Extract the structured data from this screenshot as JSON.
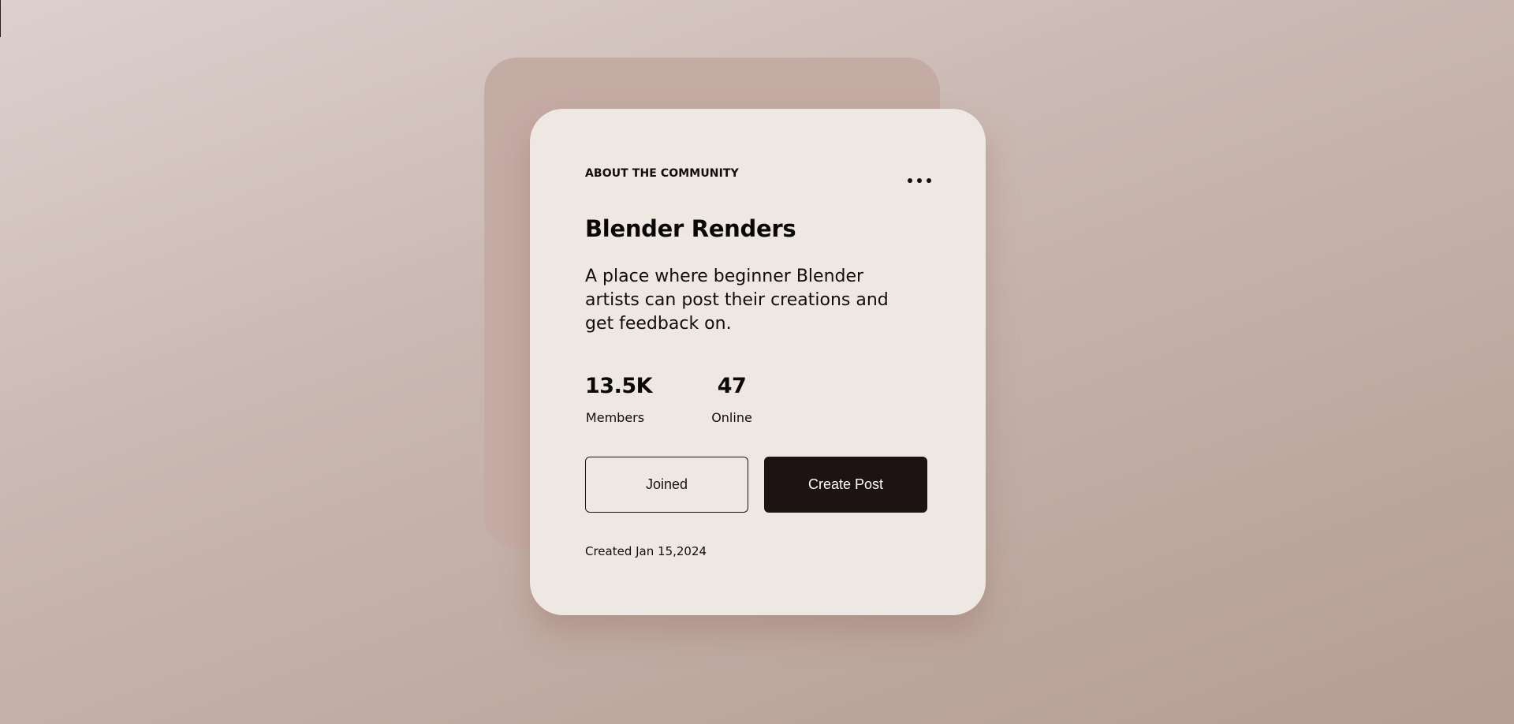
{
  "community": {
    "section_label": "ABOUT THE COMMUNITY",
    "name": "Blender Renders",
    "description": "A place where beginner Blender artists can post their creations and get feedback on.",
    "stats": {
      "members_value": "13.5K",
      "members_label": "Members",
      "online_value": "47",
      "online_label": "Online"
    },
    "actions": {
      "joined_label": "Joined",
      "create_post_label": "Create Post"
    },
    "created_text": "Created Jan 15,2024",
    "more_icon": "more-horizontal-icon"
  },
  "colors": {
    "card_background": "#ede8e2",
    "back_panel": "#c4aba4",
    "primary_button": "#1c1312",
    "page_gradient_start": "#ddd0cd",
    "page_gradient_end": "#b49d93"
  }
}
